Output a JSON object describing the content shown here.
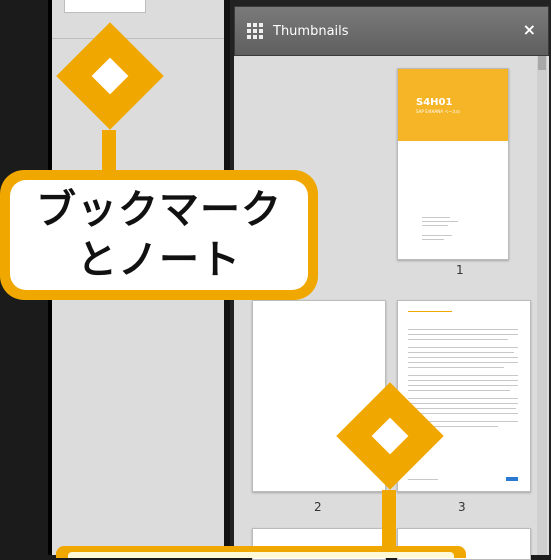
{
  "thumbnails_panel": {
    "title": "Thumbnails",
    "close_label": "×",
    "icon": "grid-icon"
  },
  "pages": [
    {
      "label": "1",
      "cover_title": "S4H01",
      "cover_subtitle": "SAP S/4HANA ベースの"
    },
    {
      "label": "2"
    },
    {
      "label": "3"
    }
  ],
  "callouts": [
    {
      "line1": "ブックマーク",
      "line2": "とノート"
    }
  ],
  "colors": {
    "accent": "#f0a800",
    "cover_band": "#f5b526",
    "header": "#6b6b6b"
  }
}
